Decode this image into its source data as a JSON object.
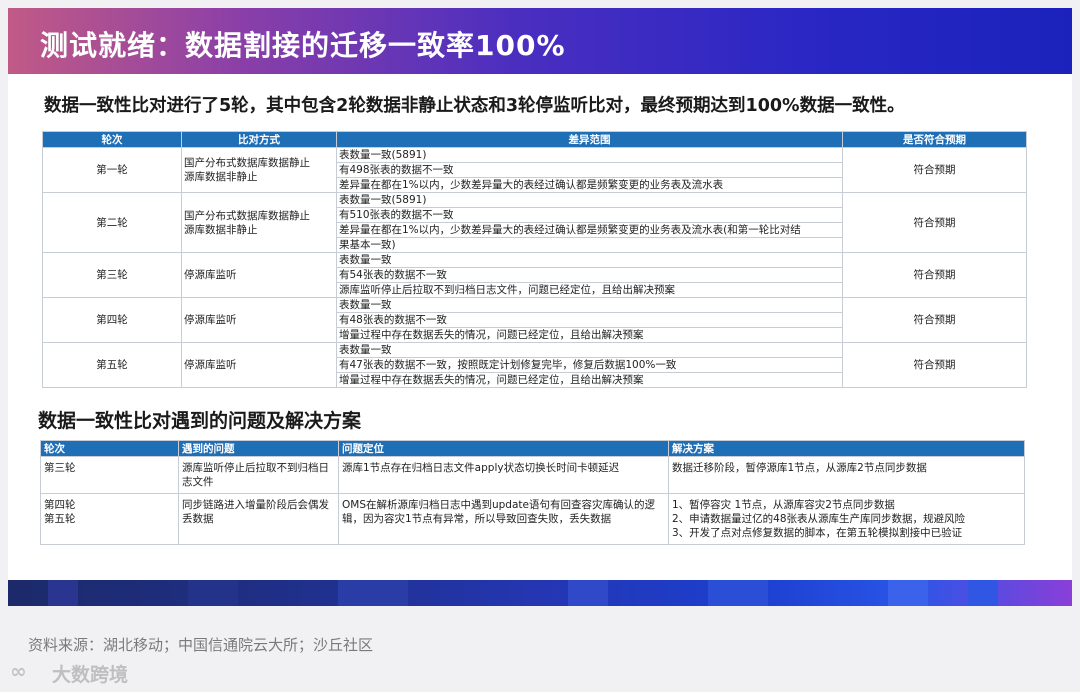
{
  "title": "测试就绪：数据割接的迁移一致率100%",
  "subtitle": "数据一致性比对进行了5轮，其中包含2轮数据非静止状态和3轮停监听比对，最终预期达到100%数据一致性。",
  "table1": {
    "headers": [
      "轮次",
      "比对方式",
      "差异范围",
      "是否符合预期"
    ],
    "rows": [
      {
        "round": "第一轮",
        "method": [
          "国产分布式数据库数据静止",
          "源库数据非静止"
        ],
        "diff": [
          "表数量一致(5891)",
          "有498张表的数据不一致",
          "差异量在都在1%以内，少数差异量大的表经过确认都是频繁变更的业务表及流水表"
        ],
        "result": "符合预期"
      },
      {
        "round": "第二轮",
        "method": [
          "国产分布式数据库数据静止",
          "源库数据非静止"
        ],
        "diff": [
          "表数量一致(5891)",
          "有510张表的数据不一致",
          "差异量在都在1%以内，少数差异量大的表经过确认都是频繁变更的业务表及流水表(和第一轮比对结",
          "果基本一致)"
        ],
        "result": "符合预期"
      },
      {
        "round": "第三轮",
        "method": [
          "停源库监听"
        ],
        "diff": [
          "表数量一致",
          "有54张表的数据不一致",
          "源库监听停止后拉取不到归档日志文件，问题已经定位，且给出解决预案"
        ],
        "result": "符合预期"
      },
      {
        "round": "第四轮",
        "method": [
          "停源库监听"
        ],
        "diff": [
          "表数量一致",
          "有48张表的数据不一致",
          "增量过程中存在数据丢失的情况，问题已经定位，且给出解决预案"
        ],
        "result": "符合预期"
      },
      {
        "round": "第五轮",
        "method": [
          "停源库监听"
        ],
        "diff": [
          "表数量一致",
          "有47张表的数据不一致，按照既定计划修复完毕，修复后数据100%一致",
          "增量过程中存在数据丢失的情况，问题已经定位，且给出解决预案"
        ],
        "result": "符合预期"
      }
    ]
  },
  "section2_title": "数据一致性比对遇到的问题及解决方案",
  "table2": {
    "headers": [
      "轮次",
      "遇到的问题",
      "问题定位",
      "解决方案"
    ],
    "rows": [
      {
        "round": [
          "第三轮"
        ],
        "problem": "源库监听停止后拉取不到归档日志文件",
        "locate": "源库1节点存在归档日志文件apply状态切换长时间卡顿延迟",
        "solution": [
          "数据迁移阶段，暂停源库1节点，从源库2节点同步数据"
        ]
      },
      {
        "round": [
          "第四轮",
          "第五轮"
        ],
        "problem": "同步链路进入增量阶段后会偶发丢数据",
        "locate": "OMS在解析源库归档日志中遇到update语句有回查容灾库确认的逻辑，因为容灾1节点有异常，所以导致回查失败，丢失数据",
        "solution": [
          "1、暂停容灾 1节点，从源库容灾2节点同步数据",
          "2、申请数据量过亿的48张表从源库生产库同步数据，规避风险",
          "3、开发了点对点修复数据的脚本，在第五轮模拟割接中已验证"
        ]
      }
    ]
  },
  "source": "资料来源：湖北移动；中国信通院云大所；沙丘社区",
  "logo_text": "大数跨境"
}
